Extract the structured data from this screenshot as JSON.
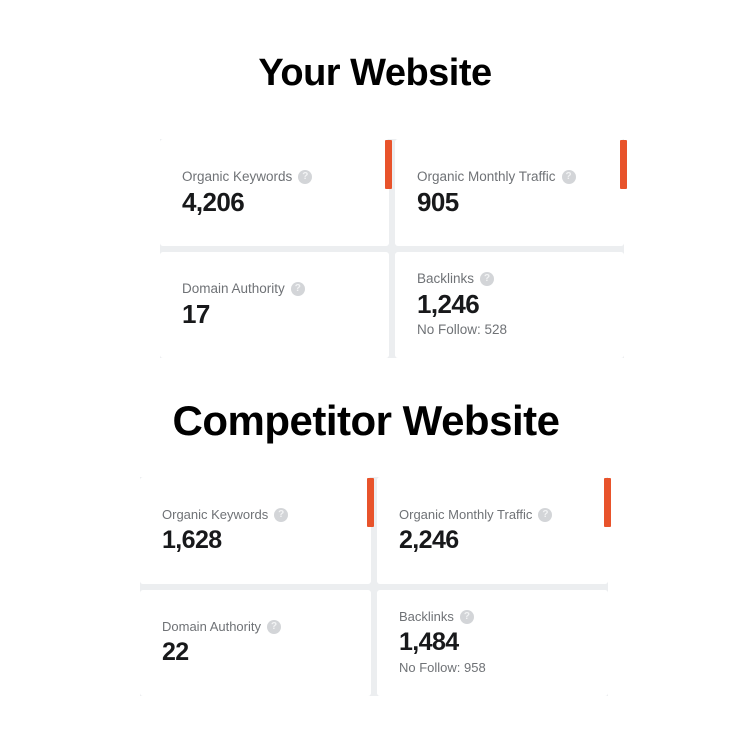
{
  "sections": [
    {
      "id": "your-website",
      "title": "Your Website",
      "cards": [
        {
          "label": "Organic Keywords",
          "value": "4,206",
          "sub": "",
          "help_icon": "help-circle-icon",
          "accent": true
        },
        {
          "label": "Organic Monthly Traffic",
          "value": "905",
          "sub": "",
          "help_icon": "help-circle-icon",
          "accent": true
        },
        {
          "label": "Domain Authority",
          "value": "17",
          "sub": "",
          "help_icon": "help-circle-icon",
          "accent": false
        },
        {
          "label": "Backlinks",
          "value": "1,246",
          "sub": "No Follow: 528",
          "help_icon": "help-circle-icon",
          "accent": false
        }
      ]
    },
    {
      "id": "competitor-website",
      "title": "Competitor Website",
      "cards": [
        {
          "label": "Organic Keywords",
          "value": "1,628",
          "sub": "",
          "help_icon": "help-circle-icon",
          "accent": true
        },
        {
          "label": "Organic Monthly Traffic",
          "value": "2,246",
          "sub": "",
          "help_icon": "help-circle-icon",
          "accent": true
        },
        {
          "label": "Domain Authority",
          "value": "22",
          "sub": "",
          "help_icon": "help-circle-icon",
          "accent": false
        },
        {
          "label": "Backlinks",
          "value": "1,484",
          "sub": "No Follow: 958",
          "help_icon": "help-circle-icon",
          "accent": false
        }
      ]
    }
  ],
  "icons": {
    "help_glyph": "?"
  },
  "colors": {
    "accent": "#e8532b",
    "card_background": "#ffffff",
    "grid_gap": "#eceef0",
    "label_text": "#6f7276",
    "value_text": "#18191b",
    "title_text": "#000000",
    "help_icon_background": "#d3d5d8"
  }
}
